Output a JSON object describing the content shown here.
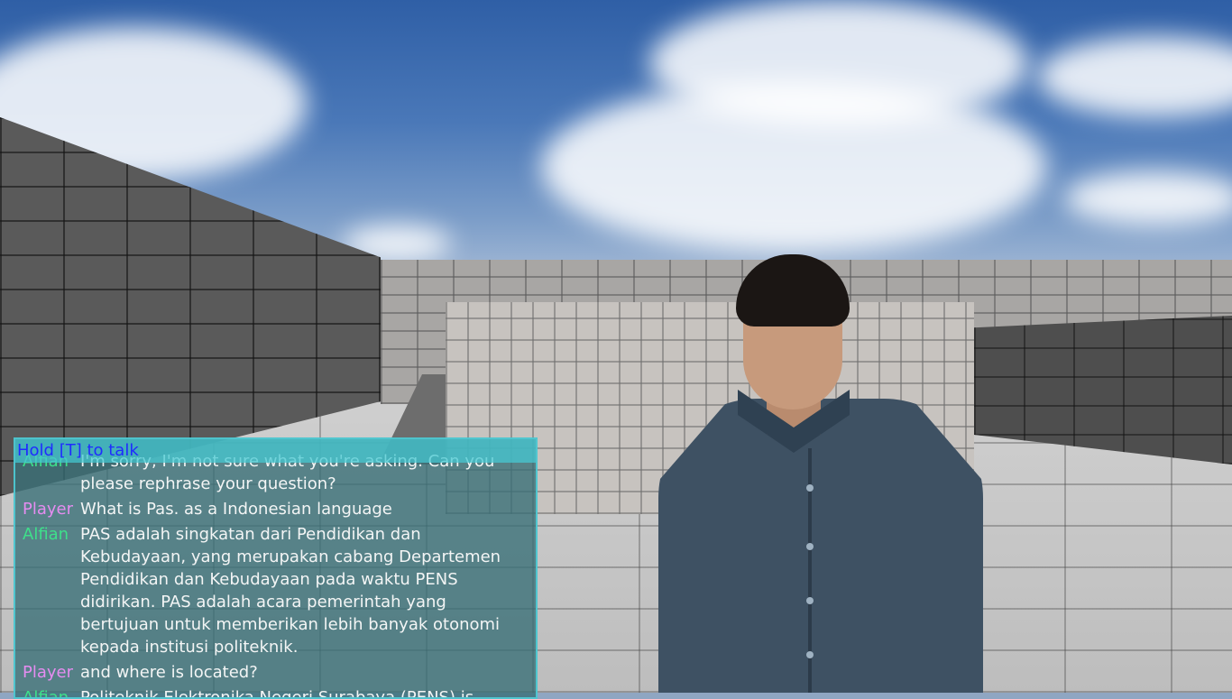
{
  "hint": "Hold [T] to talk",
  "colors": {
    "hint_text": "#1f2cff",
    "player_name": "#e58cf0",
    "npc_name": "#3ee08a",
    "message_text": "#f3f5f5",
    "panel_border": "#50d2dc"
  },
  "chat": {
    "messages": [
      {
        "speaker": "Alfian",
        "role": "npc",
        "text": "I'm sorry, I'm not sure what you're asking. Can you please rephrase your question?"
      },
      {
        "speaker": "Player",
        "role": "player",
        "text": "What is  Pas.  as a  Indonesian language"
      },
      {
        "speaker": "Alfian",
        "role": "npc",
        "text": "PAS adalah singkatan dari Pendidikan dan Kebudayaan, yang merupakan cabang Departemen Pendidikan dan Kebudayaan pada waktu PENS didirikan. PAS adalah acara pemerintah yang bertujuan untuk memberikan lebih banyak otonomi kepada institusi politeknik."
      },
      {
        "speaker": "Player",
        "role": "player",
        "text": "and where is located?"
      },
      {
        "speaker": "Alfian",
        "role": "npc",
        "text": "Politeknik Elektronika Negeri Surabaya (PENS) is"
      }
    ]
  }
}
